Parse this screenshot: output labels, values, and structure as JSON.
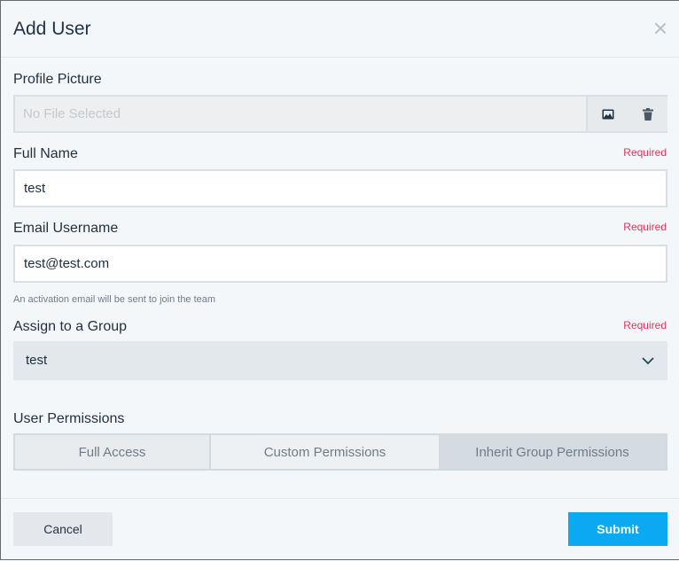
{
  "dialog": {
    "title": "Add User"
  },
  "profile": {
    "label": "Profile Picture",
    "file_placeholder": "No File Selected"
  },
  "full_name": {
    "label": "Full Name",
    "required": "Required",
    "value": "test"
  },
  "email": {
    "label": "Email Username",
    "required": "Required",
    "value": "test@test.com",
    "hint": "An activation email will be sent to join the team"
  },
  "group": {
    "label": "Assign to a Group",
    "required": "Required",
    "selected": "test"
  },
  "permissions": {
    "label": "User Permissions",
    "options": [
      "Full Access",
      "Custom Permissions",
      "Inherit Group Permissions"
    ],
    "active_index": 2
  },
  "footer": {
    "cancel_label": "Cancel",
    "submit_label": "Submit"
  },
  "colors": {
    "accent": "#0aa9f2",
    "required": "#e0335b",
    "text": "#23323f"
  }
}
